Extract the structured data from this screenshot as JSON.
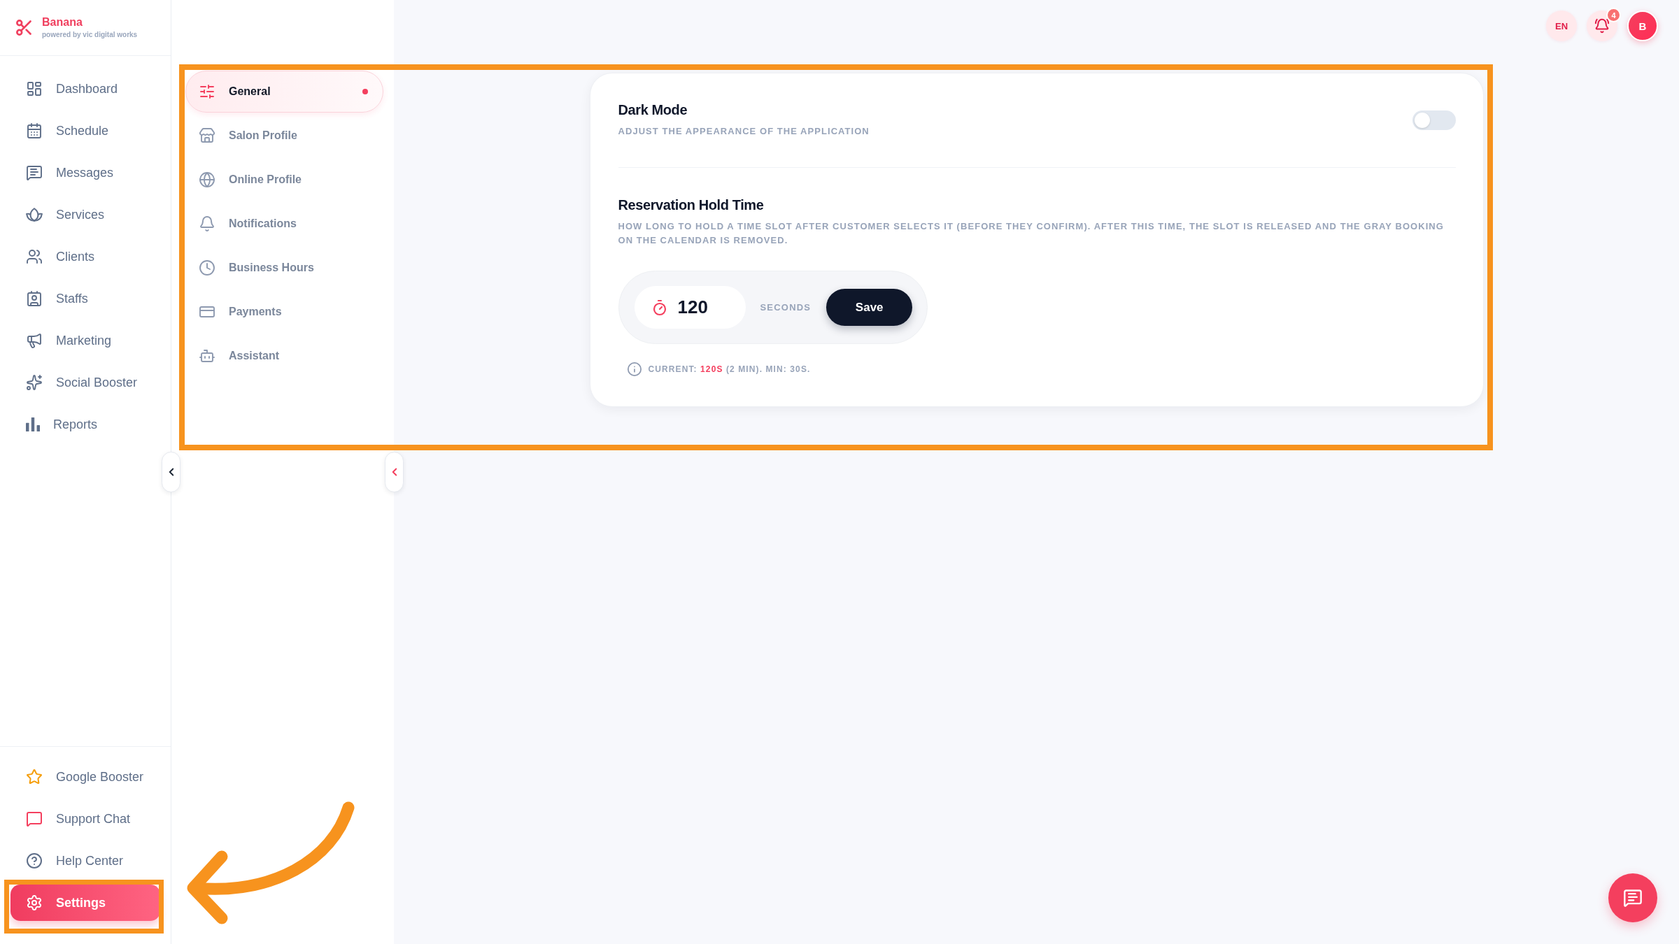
{
  "sidebar": {
    "brand": {
      "name": "Banana",
      "tagline": "powered by vic digital works"
    },
    "items": [
      {
        "label": "Dashboard",
        "selected": false
      },
      {
        "label": "Schedule",
        "selected": false
      },
      {
        "label": "Messages",
        "selected": false
      },
      {
        "label": "Services",
        "selected": false
      },
      {
        "label": "Clients",
        "selected": false
      },
      {
        "label": "Staffs",
        "selected": false
      },
      {
        "label": "Marketing",
        "selected": false
      },
      {
        "label": "Social Booster",
        "selected": false
      },
      {
        "label": "Reports",
        "selected": false
      }
    ],
    "footer_items": [
      {
        "label": "Google Booster",
        "selected": false
      },
      {
        "label": "Support Chat",
        "selected": false
      },
      {
        "label": "Help Center",
        "selected": false
      },
      {
        "label": "Settings",
        "selected": true
      }
    ]
  },
  "settings_nav": {
    "items": [
      {
        "label": "General",
        "selected": true
      },
      {
        "label": "Salon Profile",
        "selected": false
      },
      {
        "label": "Online Profile",
        "selected": false
      },
      {
        "label": "Notifications",
        "selected": false
      },
      {
        "label": "Business Hours",
        "selected": false
      },
      {
        "label": "Payments",
        "selected": false
      },
      {
        "label": "Assistant",
        "selected": false
      }
    ]
  },
  "header": {
    "language": "EN",
    "notification_count": "4",
    "avatar_initial": "B"
  },
  "general": {
    "dark_mode": {
      "title": "Dark Mode",
      "subtitle": "ADJUST THE APPEARANCE OF THE APPLICATION",
      "on": false
    },
    "hold_time": {
      "title": "Reservation Hold Time",
      "description": "HOW LONG TO HOLD A TIME SLOT AFTER CUSTOMER SELECTS IT (BEFORE THEY CONFIRM). AFTER THIS TIME, THE SLOT IS RELEASED AND THE GRAY BOOKING ON THE CALENDAR IS REMOVED.",
      "value": "120",
      "unit": "SECONDS",
      "save_label": "Save",
      "note": "CURRENT: **120S** (2 MIN). MIN: 30S."
    }
  }
}
